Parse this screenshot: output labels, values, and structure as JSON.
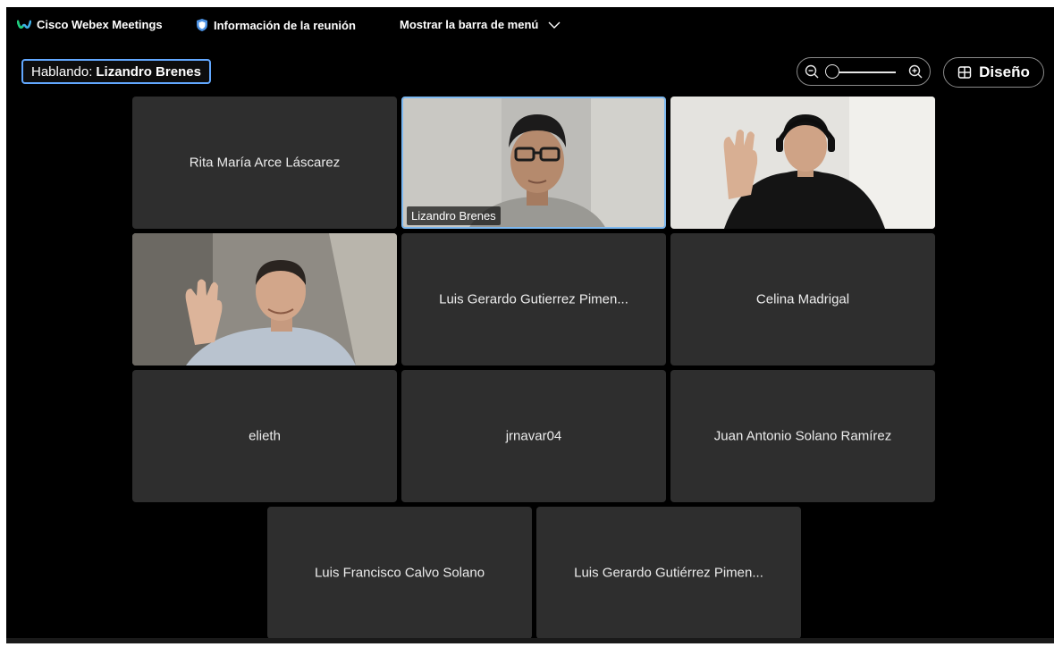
{
  "menubar": {
    "app_title": "Cisco Webex Meetings",
    "meeting_info": "Información de la reunión",
    "show_menu": "Mostrar la barra de menú"
  },
  "speaking": {
    "label": "Hablando:",
    "name": "Lizandro Brenes"
  },
  "zoom": {
    "out_icon": "zoom-out-icon",
    "in_icon": "zoom-in-icon"
  },
  "layout_button": {
    "label": "Diseño",
    "icon": "grid-icon"
  },
  "participants": [
    {
      "name": "Rita María Arce Láscarez",
      "video": false
    },
    {
      "name": "Lizandro Brenes",
      "video": true,
      "active_speaker": true
    },
    {
      "name": "",
      "video": true
    },
    {
      "name": "",
      "video": true
    },
    {
      "name": "Luis Gerardo Gutierrez Pimen...",
      "video": false
    },
    {
      "name": "Celina Madrigal",
      "video": false
    },
    {
      "name": "elieth",
      "video": false
    },
    {
      "name": "jrnavar04",
      "video": false
    },
    {
      "name": "Juan Antonio Solano Ramírez",
      "video": false
    },
    {
      "name": "Luis Francisco Calvo Solano",
      "video": false
    },
    {
      "name": "Luis Gerardo Gutiérrez Pimen...",
      "video": false
    }
  ],
  "colors": {
    "background": "#000000",
    "tile": "#2e2e2e",
    "active_border": "#7cb8f0",
    "speaking_border": "#62a8ff",
    "accent_shield": "#4a90e2"
  }
}
